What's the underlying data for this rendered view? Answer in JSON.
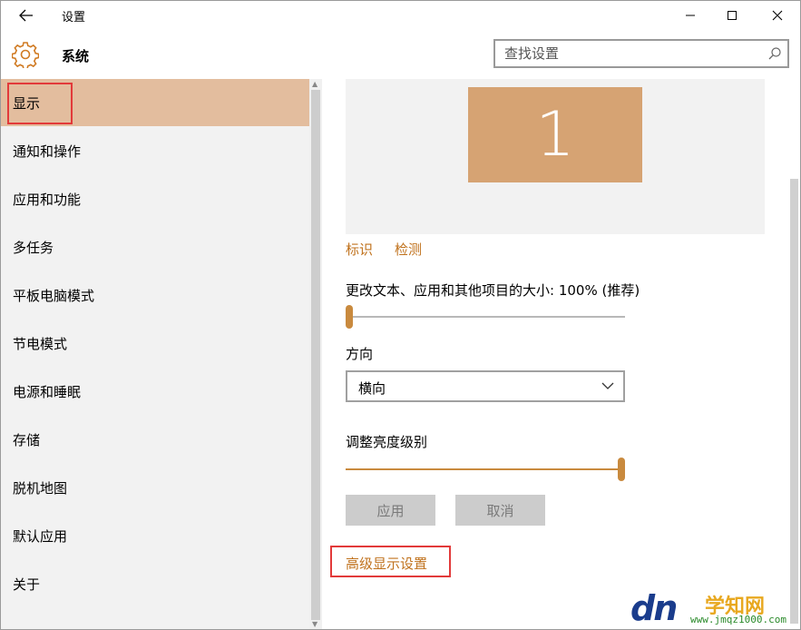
{
  "window": {
    "title": "设置",
    "back_icon": "back-arrow-icon",
    "controls": [
      "minimize-icon",
      "maximize-icon",
      "close-icon"
    ]
  },
  "header": {
    "icon": "gear-icon",
    "section_title": "系统",
    "search": {
      "placeholder": "查找设置",
      "value": "",
      "icon": "search-icon"
    }
  },
  "sidebar": {
    "items": [
      {
        "label": "显示",
        "selected": true
      },
      {
        "label": "通知和操作"
      },
      {
        "label": "应用和功能"
      },
      {
        "label": "多任务"
      },
      {
        "label": "平板电脑模式"
      },
      {
        "label": "节电模式"
      },
      {
        "label": "电源和睡眠"
      },
      {
        "label": "存储"
      },
      {
        "label": "脱机地图"
      },
      {
        "label": "默认应用"
      },
      {
        "label": "关于"
      }
    ]
  },
  "main": {
    "monitor_number": "1",
    "identify_link": "标识",
    "detect_link": "检测",
    "scale": {
      "label": "更改文本、应用和其他项目的大小: 100% (推荐)",
      "value_fraction": 0.0
    },
    "orientation": {
      "label": "方向",
      "selected": "横向"
    },
    "brightness": {
      "label": "调整亮度级别",
      "value_fraction": 1.0
    },
    "apply_button": "应用",
    "cancel_button": "取消",
    "advanced_link": "高级显示设置"
  },
  "watermark": {
    "logo": "dn",
    "site_name": "学知网",
    "url": "www.jmqz1000.com"
  },
  "colors": {
    "accent": "#c0721d",
    "selected_bg": "#e3bd9e",
    "monitor_tile": "#d6a373",
    "highlight_box": "#e23a3a"
  }
}
